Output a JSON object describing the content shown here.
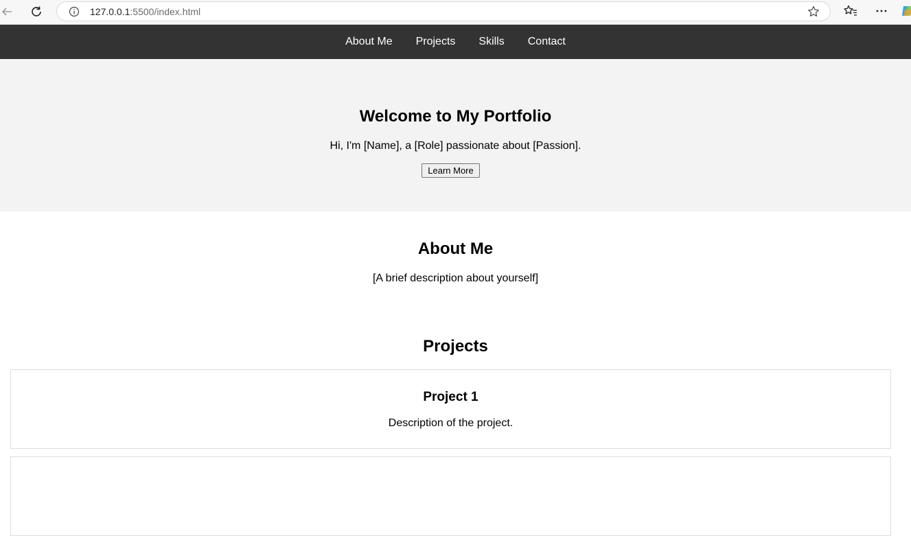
{
  "browser": {
    "url_host": "127.0.0.1",
    "url_rest": ":5500/index.html",
    "icons": [
      "back-arrow-icon",
      "reload-icon",
      "info-icon",
      "star-icon",
      "favorites-icon",
      "more-icon",
      "copilot-icon"
    ]
  },
  "nav": {
    "items": [
      "About Me",
      "Projects",
      "Skills",
      "Contact"
    ]
  },
  "hero": {
    "title": "Welcome to My Portfolio",
    "tagline": "Hi, I'm [Name], a [Role] passionate about [Passion].",
    "button_label": "Learn More"
  },
  "about": {
    "title": "About Me",
    "text": "[A brief description about yourself]"
  },
  "projects": {
    "title": "Projects",
    "items": [
      {
        "title": "Project 1",
        "description": "Description of the project."
      },
      {
        "title": "",
        "description": ""
      }
    ]
  },
  "colors": {
    "nav_bg": "#333333",
    "hero_bg": "#f3f3f3",
    "card_border": "#dddddd"
  }
}
